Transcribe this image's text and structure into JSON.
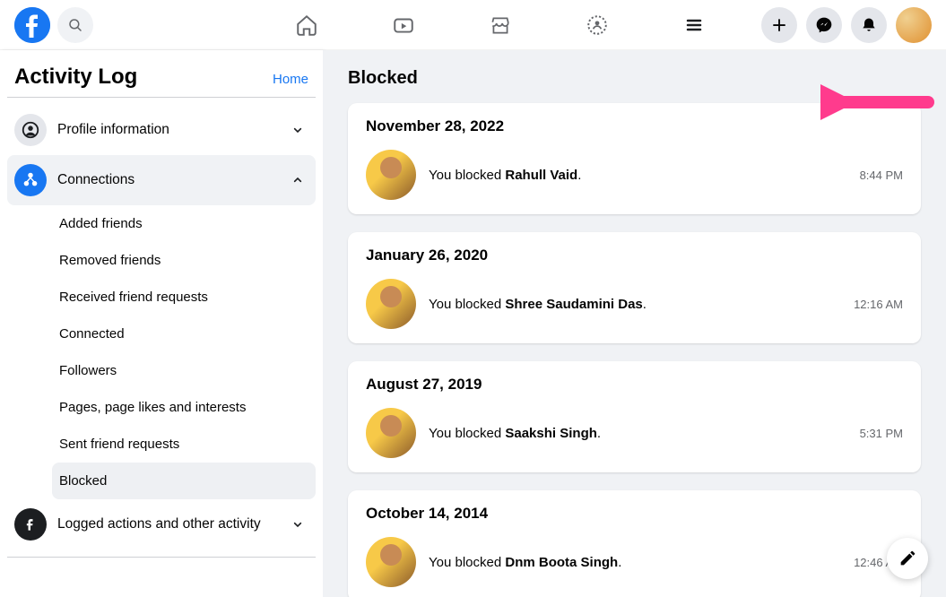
{
  "sidebar": {
    "title": "Activity Log",
    "home": "Home",
    "sections": {
      "profile": "Profile information",
      "connections": "Connections",
      "logged": "Logged actions and other activity"
    },
    "conn_items": [
      "Added friends",
      "Removed friends",
      "Received friend requests",
      "Connected",
      "Followers",
      "Pages, page likes and interests",
      "Sent friend requests",
      "Blocked"
    ]
  },
  "main": {
    "title": "Blocked",
    "action_prefix": "You blocked ",
    "entries": [
      {
        "date": "November 28, 2022",
        "name": "Rahull Vaid",
        "time": "8:44 PM"
      },
      {
        "date": "January 26, 2020",
        "name": "Shree Saudamini Das",
        "time": "12:16 AM"
      },
      {
        "date": "August 27, 2019",
        "name": "Saakshi Singh",
        "time": "5:31 PM"
      },
      {
        "date": "October 14, 2014",
        "name": "Dnm Boota Singh",
        "time": "12:46 AM"
      }
    ]
  }
}
